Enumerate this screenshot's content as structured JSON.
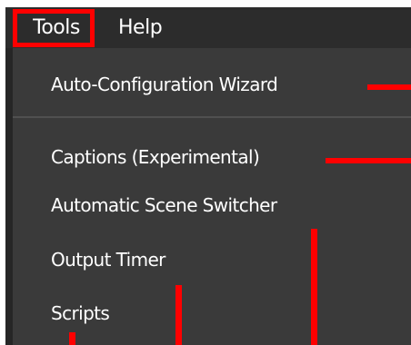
{
  "menubar": {
    "items": [
      {
        "label": "Tools"
      },
      {
        "label": "Help"
      }
    ]
  },
  "tools_menu": {
    "items": [
      {
        "label": "Auto-Configuration Wizard"
      },
      {
        "label": "Captions (Experimental)"
      },
      {
        "label": "Automatic Scene Switcher"
      },
      {
        "label": "Output Timer"
      },
      {
        "label": "Scripts"
      }
    ]
  },
  "colors": {
    "menubar_bg": "#2c2c2c",
    "dropdown_bg": "#3a3a3a",
    "highlight": "#ff0000",
    "text": "#ffffff"
  }
}
